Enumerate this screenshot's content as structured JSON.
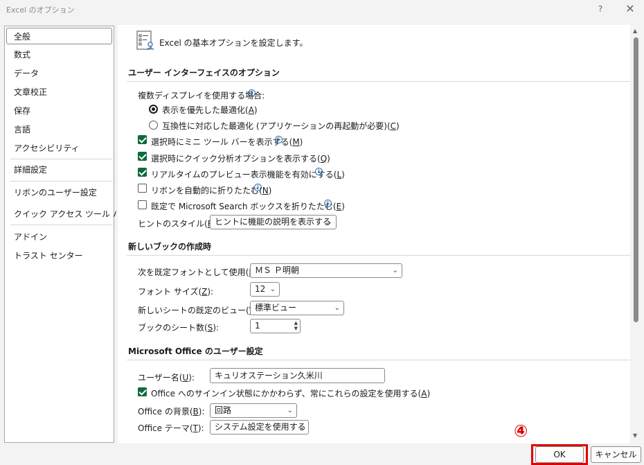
{
  "window": {
    "title": "Excel のオプション",
    "help": "?",
    "close": "✕"
  },
  "nav": [
    {
      "label": "全般"
    },
    {
      "label": "数式"
    },
    {
      "label": "データ"
    },
    {
      "label": "文章校正"
    },
    {
      "label": "保存"
    },
    {
      "label": "言語"
    },
    {
      "label": "アクセシビリティ"
    },
    {
      "label": "詳細設定"
    },
    {
      "label": "リボンのユーザー設定"
    },
    {
      "label": "クイック アクセス ツール バー"
    },
    {
      "label": "アドイン"
    },
    {
      "label": "トラスト センター"
    }
  ],
  "header": {
    "text": "Excel の基本オプションを設定します。"
  },
  "ui_section": {
    "title": "ユーザー インターフェイスのオプション",
    "multi_display": {
      "label": "複数ディスプレイを使用する場合:"
    },
    "radio1": {
      "pre": "表示を優先した最適化(",
      "key": "A",
      "post": ")"
    },
    "radio2": {
      "pre": "互換性に対応した最適化 (アプリケーションの再起動が必要)(",
      "key": "C",
      "post": ")"
    },
    "cb1": {
      "pre": "選択時にミニ ツール バーを表示する(",
      "key": "M",
      "post": ")"
    },
    "cb2": {
      "pre": "選択時にクイック分析オプションを表示する(",
      "key": "Q",
      "post": ")"
    },
    "cb3": {
      "pre": "リアルタイムのプレビュー表示機能を有効にする(",
      "key": "L",
      "post": ")"
    },
    "cb4": {
      "pre": "リボンを自動的に折りたたむ(",
      "key": "N",
      "post": ")"
    },
    "cb5": {
      "pre": "既定で Microsoft Search ボックスを折りたたむ(",
      "key": "E",
      "post": ")"
    },
    "hint": {
      "pre": "ヒントのスタイル(",
      "key": "R",
      "post": "):",
      "value": "ヒントに機能の説明を表示する"
    }
  },
  "book_section": {
    "title": "新しいブックの作成時",
    "font": {
      "pre": "次を既定フォントとして使用(",
      "key": "N",
      "post": "):",
      "value": "ＭＳ Ｐ明朝"
    },
    "size": {
      "pre": "フォント サイズ(",
      "key": "Z",
      "post": "):",
      "value": "12"
    },
    "view": {
      "pre": "新しいシートの既定のビュー(",
      "key": "V",
      "post": "):",
      "value": "標準ビュー"
    },
    "sheets": {
      "pre": "ブックのシート数(",
      "key": "S",
      "post": "):",
      "value": "1"
    }
  },
  "office_section": {
    "title": "Microsoft Office のユーザー設定",
    "username": {
      "pre": "ユーザー名(",
      "key": "U",
      "post": "):",
      "value": "キュリオステーション久米川"
    },
    "cb_signin": {
      "pre": "Office へのサインイン状態にかかわらず、常にこれらの設定を使用する(",
      "key": "A",
      "post": ")"
    },
    "background": {
      "pre": "Office の背景(",
      "key": "B",
      "post": "):",
      "value": "回路"
    },
    "theme": {
      "pre": "Office テーマ(",
      "key": "T",
      "post": "):",
      "value": "システム設定を使用する"
    }
  },
  "buttons": {
    "ok": "OK",
    "cancel": "キャンセル"
  },
  "annotation": {
    "step": "④"
  },
  "colors": {
    "checkbox": "#0f6a3d",
    "highlight": "#e10000",
    "info": "#2b6cb0"
  }
}
